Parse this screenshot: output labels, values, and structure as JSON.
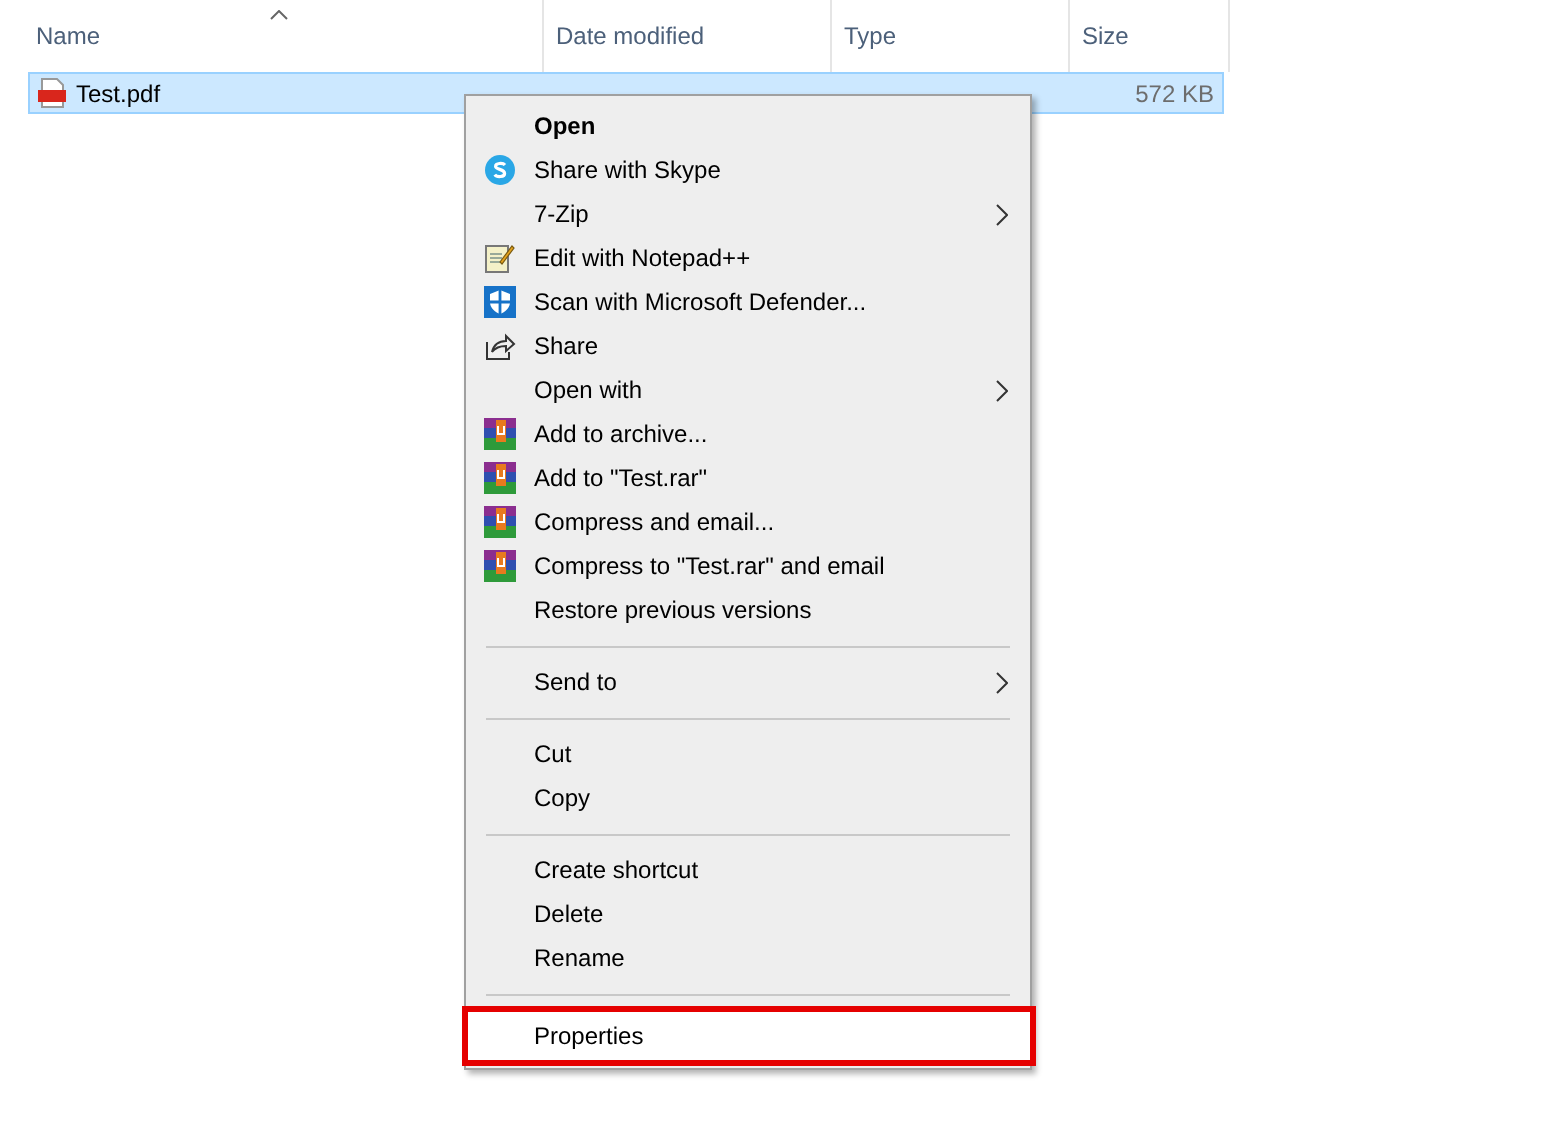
{
  "columns": [
    {
      "label": "Name",
      "sorted": true
    },
    {
      "label": "Date modified",
      "sorted": false
    },
    {
      "label": "Type",
      "sorted": false
    },
    {
      "label": "Size",
      "sorted": false
    }
  ],
  "files": [
    {
      "name": "Test.pdf",
      "size": "572 KB",
      "selected": true
    }
  ],
  "context_menu": [
    {
      "kind": "plain",
      "label": "Open",
      "default": true,
      "submenu": false,
      "selected": false
    },
    {
      "kind": "skype",
      "label": "Share with Skype",
      "default": false,
      "submenu": false,
      "selected": false
    },
    {
      "kind": "plain",
      "label": "7-Zip",
      "default": false,
      "submenu": true,
      "selected": false
    },
    {
      "kind": "notepad",
      "label": "Edit with Notepad++",
      "default": false,
      "submenu": false,
      "selected": false
    },
    {
      "kind": "defender",
      "label": "Scan with Microsoft Defender...",
      "default": false,
      "submenu": false,
      "selected": false
    },
    {
      "kind": "share",
      "label": "Share",
      "default": false,
      "submenu": false,
      "selected": false
    },
    {
      "kind": "plain",
      "label": "Open with",
      "default": false,
      "submenu": true,
      "selected": false
    },
    {
      "kind": "archive",
      "label": "Add to archive...",
      "default": false,
      "submenu": false,
      "selected": false
    },
    {
      "kind": "archive",
      "label": "Add to \"Test.rar\"",
      "default": false,
      "submenu": false,
      "selected": false
    },
    {
      "kind": "archive",
      "label": "Compress and email...",
      "default": false,
      "submenu": false,
      "selected": false
    },
    {
      "kind": "archive",
      "label": "Compress to \"Test.rar\" and email",
      "default": false,
      "submenu": false,
      "selected": false
    },
    {
      "kind": "plain",
      "label": "Restore previous versions",
      "default": false,
      "submenu": false,
      "selected": false
    },
    {
      "kind": "separator"
    },
    {
      "kind": "plain",
      "label": "Send to",
      "default": false,
      "submenu": true,
      "selected": false
    },
    {
      "kind": "separator"
    },
    {
      "kind": "plain",
      "label": "Cut",
      "default": false,
      "submenu": false,
      "selected": false
    },
    {
      "kind": "plain",
      "label": "Copy",
      "default": false,
      "submenu": false,
      "selected": false
    },
    {
      "kind": "separator"
    },
    {
      "kind": "plain",
      "label": "Create shortcut",
      "default": false,
      "submenu": false,
      "selected": false
    },
    {
      "kind": "plain",
      "label": "Delete",
      "default": false,
      "submenu": false,
      "selected": false
    },
    {
      "kind": "plain",
      "label": "Rename",
      "default": false,
      "submenu": false,
      "selected": false
    },
    {
      "kind": "separator"
    },
    {
      "kind": "plain",
      "label": "Properties",
      "default": false,
      "submenu": false,
      "selected": true
    }
  ]
}
